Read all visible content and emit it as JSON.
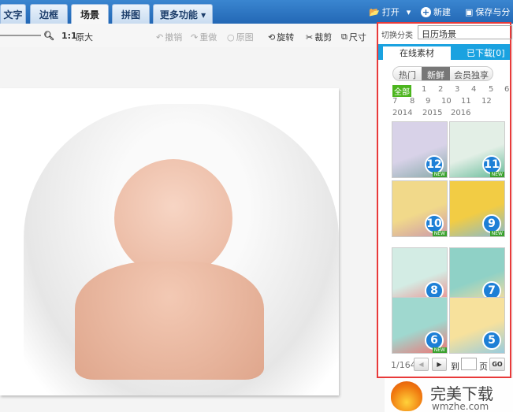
{
  "tabs": [
    {
      "label": "文字"
    },
    {
      "label": "边框"
    },
    {
      "label": "场景"
    },
    {
      "label": "拼图"
    },
    {
      "label": "更多功能 ▾"
    }
  ],
  "top_actions": {
    "open": "打开",
    "new": "新建",
    "save": "保存与分"
  },
  "toolbar": {
    "ratio": "1:1",
    "original_size": "原大",
    "undo": "撤销",
    "redo": "重做",
    "original": "原图",
    "rotate": "旋转",
    "crop": "裁剪",
    "size": "尺寸"
  },
  "panel": {
    "category_label": "切换分类",
    "category_value": "日历场景",
    "tab_online": "在线素材",
    "tab_downloaded": "已下载[0]",
    "filters": [
      "热门",
      "新鲜",
      "会员独享"
    ],
    "months": [
      "全部",
      "1",
      "2",
      "3",
      "4",
      "5",
      "6",
      "7",
      "8",
      "9",
      "10",
      "11",
      "12",
      "2014",
      "2015",
      "2016"
    ],
    "thumbs": [
      {
        "num": "12"
      },
      {
        "num": "11"
      },
      {
        "num": "10"
      },
      {
        "num": "9"
      },
      {
        "num": "8"
      },
      {
        "num": "7"
      },
      {
        "num": "6"
      },
      {
        "num": "5"
      }
    ],
    "new_badge": "NEW",
    "pager": {
      "page": "1/164",
      "goto": "到",
      "page_unit": "页",
      "go": "GO"
    }
  },
  "watermark": {
    "title": "完美下载",
    "url": "wmzhe.com"
  }
}
